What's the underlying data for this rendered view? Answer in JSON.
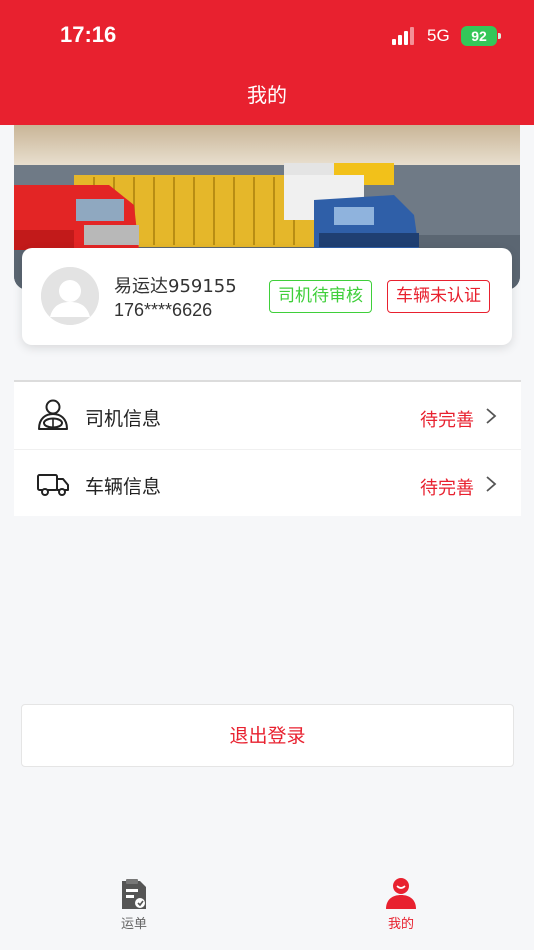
{
  "status_bar": {
    "time": "17:16",
    "network": "5G",
    "battery": "92"
  },
  "nav": {
    "title": "我的"
  },
  "profile": {
    "name": "易运达959155",
    "phone": "176****6626",
    "driver_badge": "司机待审核",
    "vehicle_badge": "车辆未认证"
  },
  "menu": {
    "items": [
      {
        "label": "司机信息",
        "status": "待完善",
        "icon": "driver-icon"
      },
      {
        "label": "车辆信息",
        "status": "待完善",
        "icon": "truck-icon"
      }
    ]
  },
  "logout": {
    "label": "退出登录"
  },
  "tabbar": {
    "tabs": [
      {
        "label": "运单",
        "icon": "waybill-icon",
        "active": false
      },
      {
        "label": "我的",
        "icon": "user-icon",
        "active": true
      }
    ]
  },
  "colors": {
    "brand": "#e8212f",
    "success": "#3fcf3a",
    "battery": "#34c759"
  }
}
